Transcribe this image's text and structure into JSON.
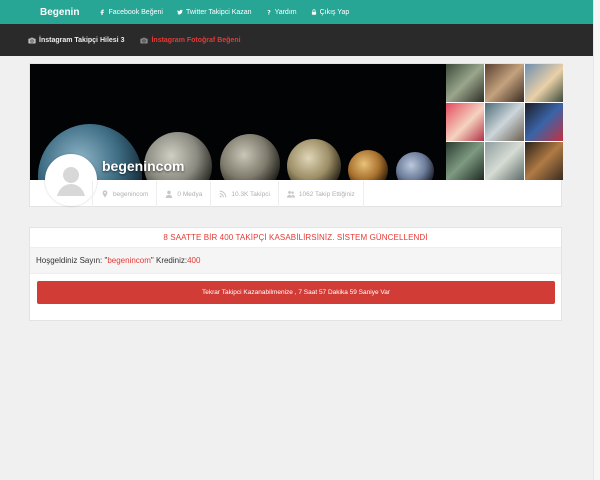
{
  "nav": {
    "brand": "Begenin",
    "items": [
      {
        "label": "Facebook Beğeni",
        "icon": "facebook-icon"
      },
      {
        "label": "Twitter Takipci Kazan",
        "icon": "twitter-icon"
      },
      {
        "label": "Yardım",
        "icon": "question-icon"
      },
      {
        "label": "Çıkış Yap",
        "icon": "lock-icon"
      }
    ]
  },
  "subnav": {
    "items": [
      {
        "label": "İnstagram Takipçi Hilesi 3",
        "icon": "camera-icon",
        "active": false
      },
      {
        "label": "İnstagram Fotoğraf Beğeni",
        "icon": "camera-icon",
        "active": true
      }
    ]
  },
  "profile": {
    "username": "begenincom",
    "stats": [
      {
        "label": "begenincom",
        "icon": "map-pin-icon"
      },
      {
        "label": "0 Medya",
        "icon": "user-icon"
      },
      {
        "label": "10.3K Takipci",
        "icon": "rss-icon"
      },
      {
        "label": "1062 Takip Ettiğiniz",
        "icon": "users-icon"
      }
    ]
  },
  "info": {
    "announcement": "8 SAATTE BİR 400 TAKİPÇİ KASABİLİRSİNİZ. SİSTEM GÜNCELLENDİ",
    "welcome_prefix": "Hoşgeldiniz Sayın: \"",
    "welcome_user": "begenincom",
    "welcome_mid": "\" Krediniz: ",
    "credits": "400",
    "alert": "Tekrar Takipci Kazanabilmenize , 7 Saat 57 Dakika 59 Saniye Var"
  },
  "colors": {
    "primary": "#27a595",
    "accent_red": "#e53935",
    "alert_red": "#d23c36",
    "dark": "#2a2a2a"
  }
}
